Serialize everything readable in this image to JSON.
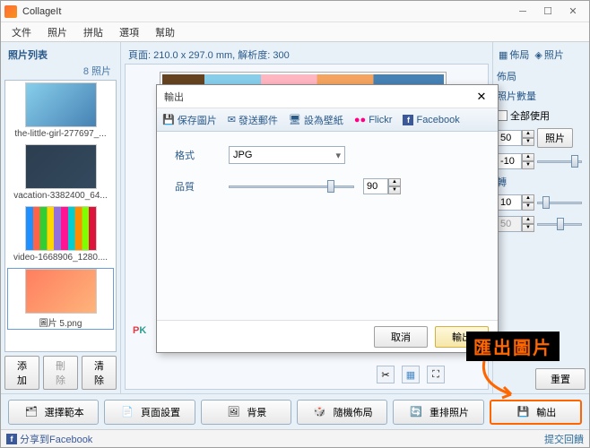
{
  "app": {
    "title": "CollageIt"
  },
  "menu": {
    "file": "文件",
    "photo": "照片",
    "collage": "拼貼",
    "options": "選項",
    "help": "幫助"
  },
  "sidebar": {
    "header": "照片列表",
    "count": "8 照片",
    "items": [
      {
        "name": "the-little-girl-277697_..."
      },
      {
        "name": "vacation-3382400_64..."
      },
      {
        "name": "video-1668906_1280...."
      },
      {
        "name": "圖片 5.png"
      }
    ],
    "add": "添加",
    "delete": "刪除",
    "clear": "清除"
  },
  "canvas": {
    "header": "頁面: 210.0 x 297.0 mm, 解析度: 300"
  },
  "right": {
    "tab_layout": "佈局",
    "tab_photo": "照片",
    "section_layout": "佈局",
    "photo_count": "照片數量",
    "use_all": "全部使用",
    "count_val": "50",
    "photo_btn": "照片",
    "val_neg10": "-10",
    "rotate": "轉",
    "rot_val": "10",
    "val_50": "50",
    "regen": "重置"
  },
  "bottom": {
    "template": "選擇範本",
    "page": "頁面設置",
    "bg": "背景",
    "shuffle": "隨機佈局",
    "rearrange": "重排照片",
    "export": "輸出"
  },
  "status": {
    "fb": "分享到Facebook",
    "feedback": "提交回饋"
  },
  "dialog": {
    "title": "輸出",
    "tabs": {
      "save": "保存圖片",
      "email": "發送郵件",
      "wallpaper": "設為壁紙",
      "flickr": "Flickr",
      "facebook": "Facebook"
    },
    "format_label": "格式",
    "format_val": "JPG",
    "quality_label": "品質",
    "quality_val": "90",
    "cancel": "取消",
    "ok": "輸出"
  },
  "annotation": {
    "text": "匯出圖片"
  },
  "watermark": {
    "p": "P",
    "k": "K"
  }
}
